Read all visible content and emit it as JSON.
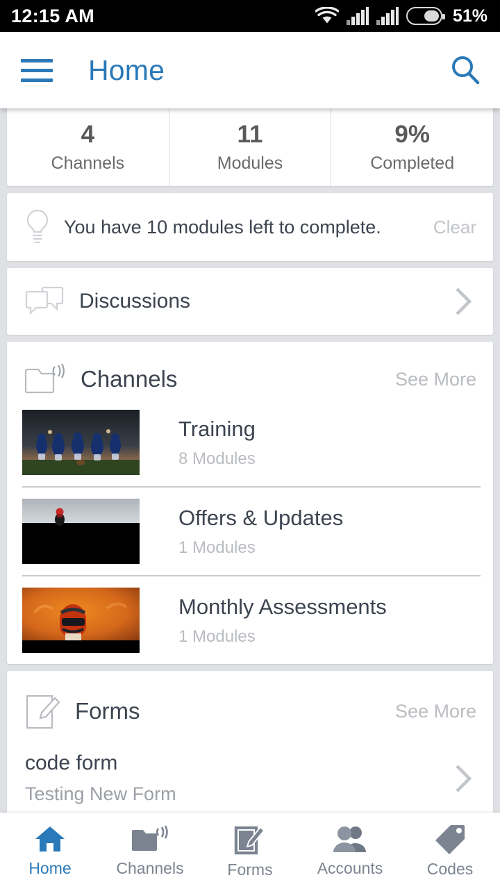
{
  "status_bar": {
    "time": "12:15 AM",
    "battery_percent": "51%",
    "battery_level": 51,
    "icons": [
      "wifi-icon",
      "cellular-signal-icon",
      "cellular-signal-2-icon",
      "battery-icon"
    ]
  },
  "app_bar": {
    "menu_icon": "hamburger-menu-icon",
    "title": "Home",
    "search_icon": "search-icon",
    "accent_color": "#2a79b8"
  },
  "stats": {
    "items": [
      {
        "value": "4",
        "label": "Channels"
      },
      {
        "value": "11",
        "label": "Modules"
      },
      {
        "value": "9%",
        "label": "Completed"
      }
    ]
  },
  "notice": {
    "icon": "lightbulb-icon",
    "text": "You have 10 modules left to complete.",
    "clear_label": "Clear"
  },
  "discussions": {
    "icon": "chat-bubbles-icon",
    "label": "Discussions",
    "chevron": "chevron-right-icon"
  },
  "channels_section": {
    "icon": "folder-broadcast-icon",
    "title": "Channels",
    "see_more_label": "See More",
    "items": [
      {
        "name": "Training",
        "modules": "8 Modules",
        "thumbnail": "football-team-photo"
      },
      {
        "name": "Offers & Updates",
        "modules": "1 Modules",
        "thumbnail": "grey-sky-rider-photo"
      },
      {
        "name": "Monthly Assessments",
        "modules": "1 Modules",
        "thumbnail": "orange-helmet-photo"
      }
    ]
  },
  "forms_section": {
    "icon": "document-pencil-icon",
    "title": "Forms",
    "see_more_label": "See More",
    "items": [
      {
        "name": "code form",
        "sub": "Testing New Form",
        "chevron": "chevron-right-icon"
      }
    ]
  },
  "bottom_nav": {
    "active_color": "#2a79b8",
    "inactive_color": "#7b8490",
    "items": [
      {
        "label": "Home",
        "icon": "home-icon",
        "active": true
      },
      {
        "label": "Channels",
        "icon": "folder-broadcast-icon",
        "active": false
      },
      {
        "label": "Forms",
        "icon": "document-pencil-icon",
        "active": false
      },
      {
        "label": "Accounts",
        "icon": "people-icon",
        "active": false
      },
      {
        "label": "Codes",
        "icon": "tag-icon",
        "active": false
      }
    ]
  }
}
